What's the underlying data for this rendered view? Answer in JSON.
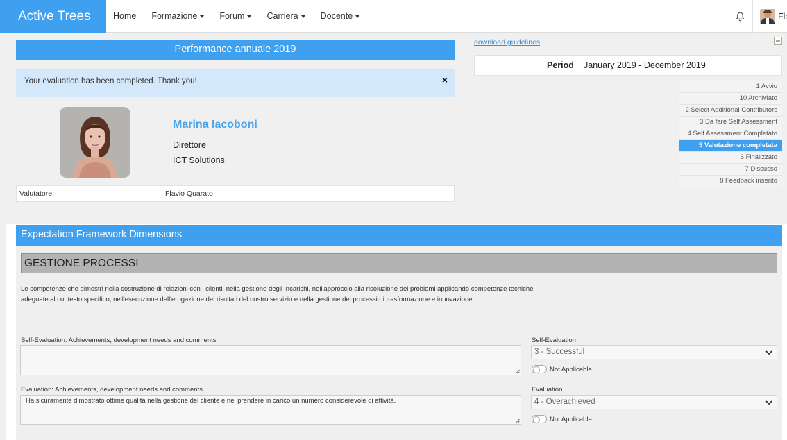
{
  "nav": {
    "brand": "Active Trees",
    "items": [
      {
        "label": "Home",
        "dropdown": false
      },
      {
        "label": "Formazione",
        "dropdown": true
      },
      {
        "label": "Forum",
        "dropdown": true
      },
      {
        "label": "Carriera",
        "dropdown": true
      },
      {
        "label": "Docente",
        "dropdown": true
      }
    ],
    "user_name_visible": "Fla",
    "icons": [
      "bell-icon",
      "user-avatar"
    ]
  },
  "performance": {
    "title": "Performance annuale 2019",
    "alert": "Your evaluation has been completed. Thank you!",
    "alert_close": "×"
  },
  "employee": {
    "name": "Marina Iacoboni",
    "role": "Direttore",
    "department": "ICT Solutions",
    "evaluator_label": "Valutatore",
    "evaluator_name": "Flavio Quarato"
  },
  "side": {
    "download_link": "download guidelines",
    "period_label": "Period",
    "period_value": "January 2019 - December 2019",
    "steps": [
      {
        "label": "1 Avvio",
        "active": false
      },
      {
        "label": "10 Archiviato",
        "active": false
      },
      {
        "label": "2 Select Additional Contributors",
        "active": false
      },
      {
        "label": "3 Da fare Self Assessment",
        "active": false
      },
      {
        "label": "4 Self Assessment Completato",
        "active": false
      },
      {
        "label": "5 Valutazione completata",
        "active": true
      },
      {
        "label": "6 Finalizzato",
        "active": false
      },
      {
        "label": "7 Discusso",
        "active": false
      },
      {
        "label": "8 Feedback inserito",
        "active": false
      }
    ]
  },
  "framework": {
    "title": "Expectation Framework Dimensions",
    "section_title": "GESTIONE PROCESSI",
    "description": "Le competenze che dimostri nella costruzione di relazioni con i clienti, nella gestione degli incarichi, nell'approccio alla risoluzione dei problemi applicando competenze tecniche adeguate al contesto specifico, nell'esecuzione dell'erogazione dei risultati del nostro servizio e nella gestione dei processi di trasformazione e innovazione",
    "self_eval_comment_label": "Self-Evaluation: Achievements, development needs and comments",
    "self_eval_comment_value": "",
    "eval_comment_label": "Evaluation: Achievements, development needs and comments",
    "eval_comment_value": "Ha sicuramente dimostrato ottime qualità nella gestione del cliente e nel prendere in carico un numero considerevole di attività.",
    "self_eval_label": "Self-Evaluation",
    "self_eval_value": "3 - Successful",
    "eval_label": "Evaluation",
    "eval_value": "4 - Overachieved",
    "not_applicable": "Not Applicable"
  },
  "colors": {
    "accent": "#3fa0ef",
    "alert_bg": "#d3e8fb",
    "section_grey": "#b3b3b3",
    "name_blue": "#4aa3ee"
  }
}
